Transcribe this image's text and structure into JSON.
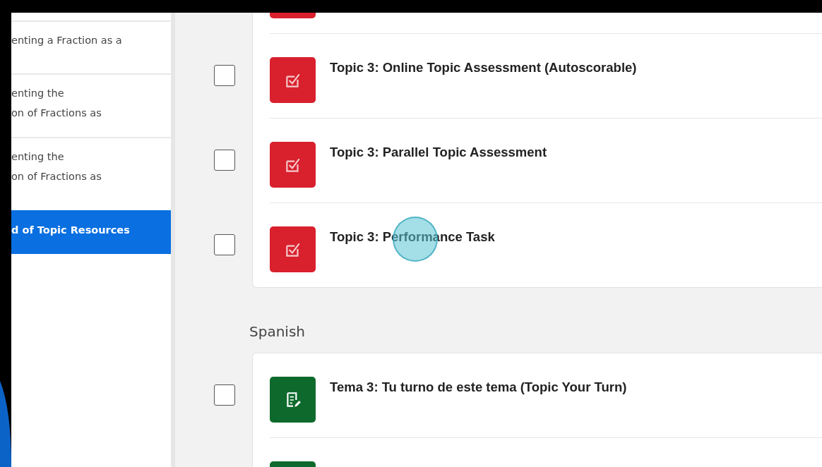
{
  "sidebar": {
    "items": [
      {
        "text": "enting a Fraction as a",
        "selected": false
      },
      {
        "text": "enting the\non of Fractions as",
        "selected": false
      },
      {
        "text": "enting the\non of Fractions as",
        "selected": false
      },
      {
        "text": "d of Topic Resources",
        "selected": true
      }
    ]
  },
  "sections": [
    {
      "items": [
        {
          "kind": "assessment"
        },
        {
          "kind": "assessment",
          "title": "Topic 3: Online Topic Assessment (Autoscorable)",
          "checked": false
        },
        {
          "kind": "assessment",
          "title": "Topic 3: Parallel Topic Assessment",
          "checked": false
        },
        {
          "kind": "assessment",
          "title": "Topic 3: Performance Task",
          "checked": false,
          "pointer": true
        }
      ]
    },
    {
      "heading": "Spanish",
      "items": [
        {
          "kind": "practice",
          "title": "Tema 3: Tu turno de este tema (Topic Your Turn)",
          "checked": false
        },
        {
          "kind": "practice"
        }
      ]
    }
  ]
}
